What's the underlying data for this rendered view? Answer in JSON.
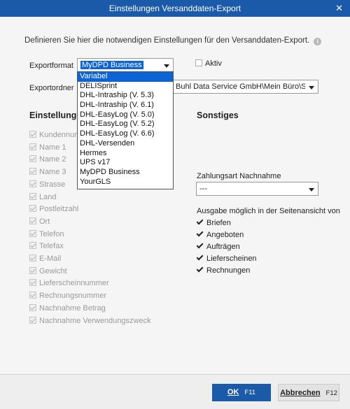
{
  "window": {
    "title": "Einstellungen Versanddaten-Export",
    "close_glyph": "✕"
  },
  "description": "Definieren Sie hier die notwendigen Einstellungen für den Versanddaten-Export.",
  "exportformat": {
    "label": "Exportformat",
    "value": "MyDPD Business",
    "options": [
      "Variabel",
      "DELISprint",
      "DHL-Intraship (V. 5.3)",
      "DHL-Intraship (V. 6.1)",
      "DHL-EasyLog (V. 5.0)",
      "DHL-EasyLog (V. 5.2)",
      "DHL-EasyLog (V. 6.6)",
      "DHL-Versenden",
      "Hermes",
      "UPS v17",
      "MyDPD Business",
      "YourGLS"
    ],
    "highlighted": "Variabel"
  },
  "aktiv": {
    "label": "Aktiv",
    "checked": false
  },
  "exportordner": {
    "label": "Exportordner",
    "value": "Buhl Data Service GmbH\\Mein Büro\\Sendung"
  },
  "einstellungen": {
    "title": "Einstellungen",
    "items": [
      "Kundennummer",
      "Name 1",
      "Name 2",
      "Name 3",
      "Strasse",
      "Land",
      "Postleitzahl",
      "Ort",
      "Telefon",
      "Telefax",
      "E-Mail",
      "Gewicht",
      "Lieferscheinnummer",
      "Rechnungsnummer",
      "Nachnahme Betrag",
      "Nachnahme Verwendungszweck"
    ]
  },
  "sonstiges": {
    "title": "Sonstiges",
    "zahlungsart_label": "Zahlungsart Nachnahme",
    "zahlungsart_value": "---",
    "ausgabe_label": "Ausgabe möglich in der Seitenansicht von",
    "ausgabe_items": [
      "Briefen",
      "Angeboten",
      "Aufträgen",
      "Lieferscheinen",
      "Rechnungen"
    ]
  },
  "buttons": {
    "ok_label": "OK",
    "ok_key": "F11",
    "cancel_label": "Abbrechen",
    "cancel_key": "F12"
  },
  "colors": {
    "titlebar": "#1b5aa8",
    "selection": "#0a64d6",
    "ok_button": "#1b5aa8"
  }
}
